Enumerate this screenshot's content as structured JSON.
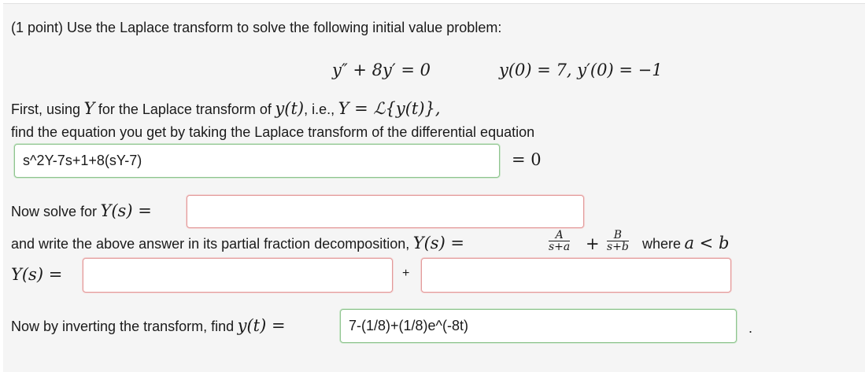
{
  "problem": {
    "intro": "(1 point) Use the Laplace transform to solve the following initial value problem:",
    "ode": "y″ + 8y′ = 0",
    "initial_conditions": "y(0) = 7,  y′(0) = −1"
  },
  "step1": {
    "text_a": "First, using",
    "Y_symbol": "Y",
    "text_b": "for the Laplace transform of",
    "yt": "y(t)",
    "text_c": ", i.e.,",
    "def": "Y = ℒ{y(t)},",
    "line2": "find the equation you get by taking the Laplace transform of the differential equation",
    "answer": "s^2Y-7s+1+8(sY-7)",
    "equals_zero": "= 0"
  },
  "step2": {
    "text": "Now solve for",
    "Ys_eq": "Y(s) =",
    "answer": ""
  },
  "step3": {
    "text": "and write the above answer in its partial fraction decomposition,",
    "Ys_eq": "Y(s) =",
    "fracA_num": "A",
    "fracA_den": "s+a",
    "plus": "+",
    "fracB_num": "B",
    "fracB_den": "s+b",
    "where": "where",
    "condition": "a < b",
    "Ys_label": "Y(s) =",
    "answer1": "",
    "plus_sign": "+",
    "answer2": ""
  },
  "step4": {
    "text": "Now by inverting the transform, find",
    "yt_eq": "y(t) =",
    "answer": "7-(1/8)+(1/8)e^(-8t)",
    "period": "."
  }
}
